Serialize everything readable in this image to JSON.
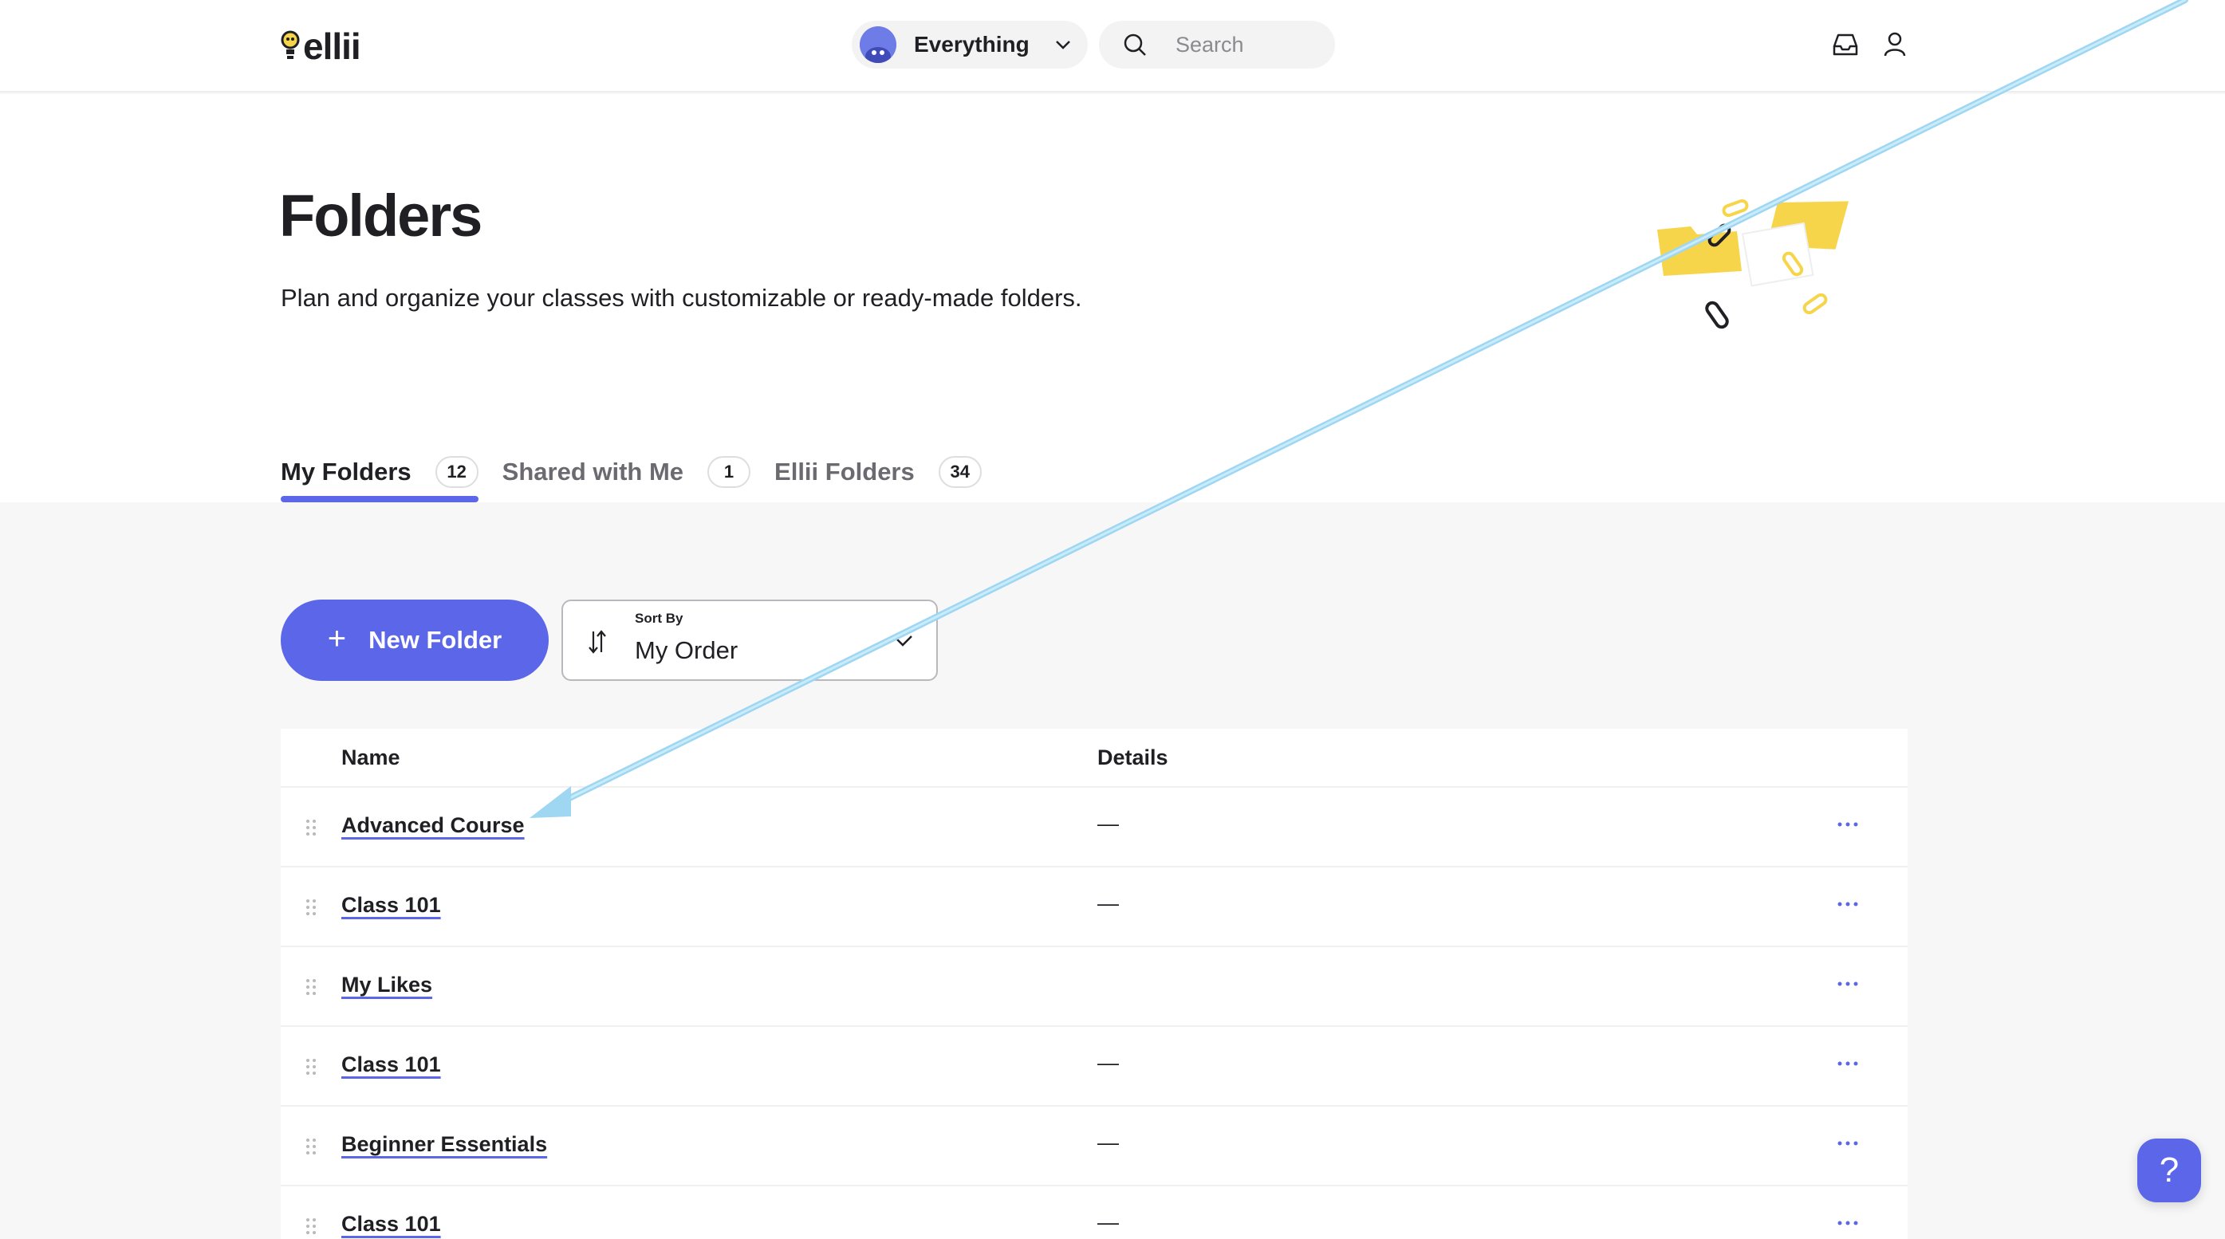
{
  "header": {
    "logo_text": "ellii",
    "scope_label": "Everything",
    "search_placeholder": "Search",
    "inbox_icon": "inbox-icon",
    "user_icon": "user-icon"
  },
  "hero": {
    "title": "Folders",
    "subtitle": "Plan and organize your classes with customizable or ready-made folders."
  },
  "tabs": [
    {
      "label": "My Folders",
      "count": "12",
      "active": true
    },
    {
      "label": "Shared with Me",
      "count": "1",
      "active": false
    },
    {
      "label": "Ellii Folders",
      "count": "34",
      "active": false
    }
  ],
  "toolbar": {
    "new_folder_label": "New Folder",
    "sort_caption": "Sort By",
    "sort_value": "My Order"
  },
  "table": {
    "columns": [
      "Name",
      "Details"
    ],
    "rows": [
      {
        "name": "Advanced Course",
        "details": "—"
      },
      {
        "name": "Class 101",
        "details": "—"
      },
      {
        "name": "My Likes",
        "details": ""
      },
      {
        "name": "Class 101",
        "details": "—"
      },
      {
        "name": "Beginner Essentials",
        "details": "—"
      },
      {
        "name": "Class 101",
        "details": "—"
      }
    ]
  },
  "help": {
    "label": "?"
  },
  "colors": {
    "accent": "#5b67e8",
    "folder_yellow": "#f7d54a",
    "annotation_arrow": "#a8dcf5"
  }
}
